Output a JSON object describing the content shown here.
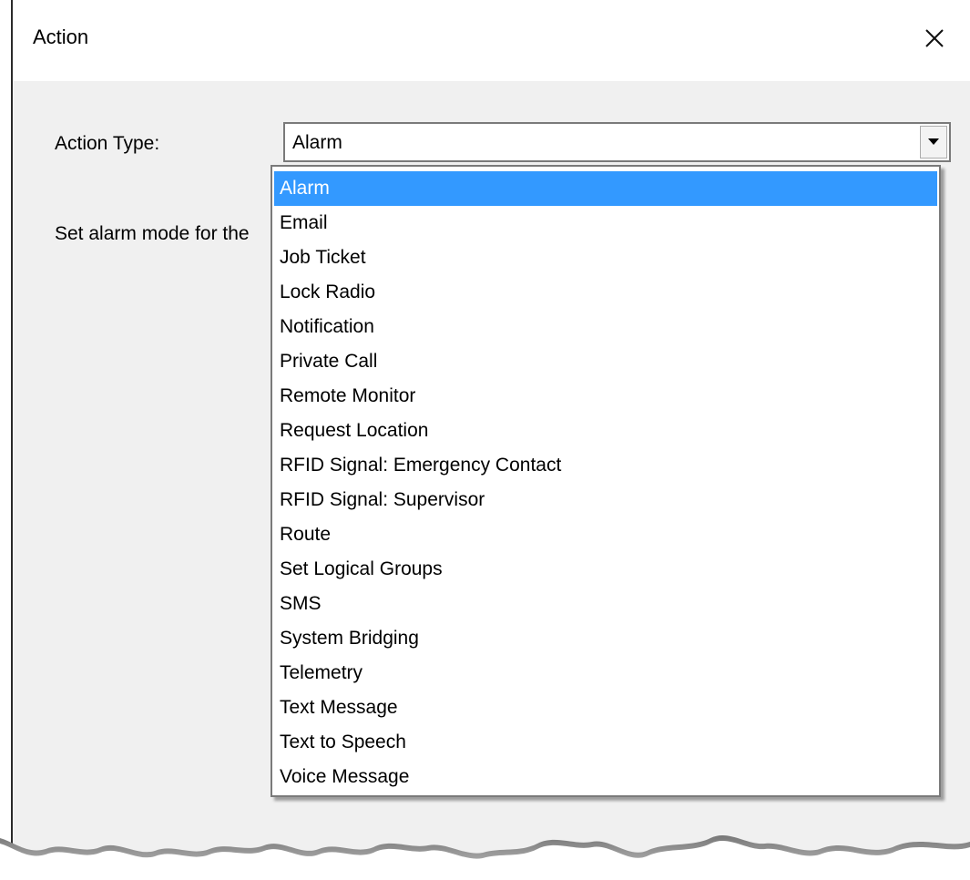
{
  "dialog": {
    "title": "Action",
    "close_icon": "close-icon"
  },
  "form": {
    "action_type_label": "Action Type:",
    "description_label": "Set alarm mode for the"
  },
  "action_type_combo": {
    "selected_value": "Alarm",
    "arrow_icon": "chevron-down-icon"
  },
  "dropdown": {
    "highlighted_index": 0,
    "options": [
      "Alarm",
      "Email",
      "Job Ticket",
      "Lock Radio",
      "Notification",
      "Private Call",
      "Remote Monitor",
      "Request Location",
      "RFID Signal: Emergency Contact",
      "RFID Signal: Supervisor",
      "Route",
      "Set Logical Groups",
      "SMS",
      "System Bridging",
      "Telemetry",
      "Text Message",
      "Text to Speech",
      "Voice Message"
    ]
  },
  "colors": {
    "selection": "#3399ff",
    "dialog_background": "#f0f0f0",
    "titlebar_background": "#ffffff"
  }
}
